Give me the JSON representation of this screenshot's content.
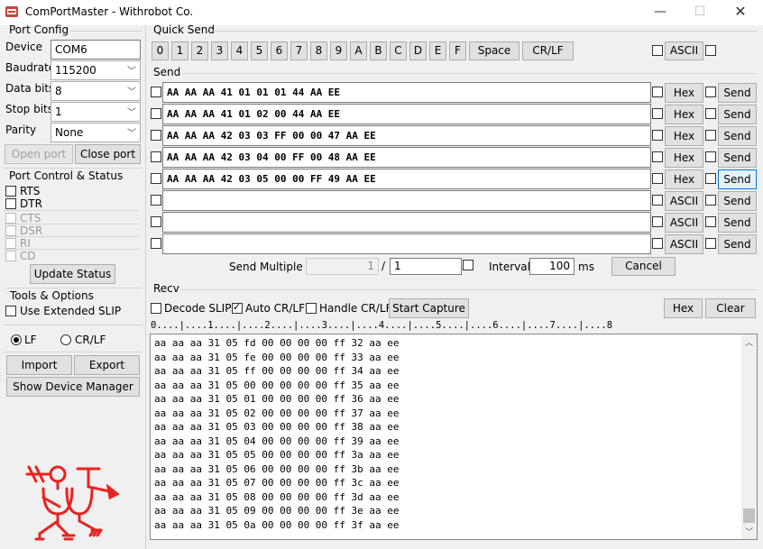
{
  "window": {
    "title": "ComPortMaster - Withrobot Co."
  },
  "port_config": {
    "title": "Port Config",
    "device_label": "Device",
    "device_value": "COM6",
    "baudrate_label": "Baudrate",
    "baudrate_value": "115200",
    "databits_label": "Data bits",
    "databits_value": "8",
    "stopbits_label": "Stop bits",
    "stopbits_value": "1",
    "parity_label": "Parity",
    "parity_value": "None",
    "open_label": "Open port",
    "close_label": "Close port"
  },
  "port_control": {
    "title": "Port Control & Status",
    "rts": "RTS",
    "dtr": "DTR",
    "cts": "CTS",
    "dsr": "DSR",
    "ri": "RI",
    "cd": "CD",
    "update_label": "Update Status"
  },
  "tools": {
    "title": "Tools & Options",
    "extended_slip": "Use Extended SLIP",
    "lf": "LF",
    "crlf": "CR/LF",
    "import_label": "Import",
    "export_label": "Export",
    "device_manager_label": "Show Device Manager"
  },
  "quick_send": {
    "title": "Quick Send",
    "keys": [
      "0",
      "1",
      "2",
      "3",
      "4",
      "5",
      "6",
      "7",
      "8",
      "9",
      "A",
      "B",
      "C",
      "D",
      "E",
      "F"
    ],
    "space_label": "Space",
    "crlf_label": "CR/LF",
    "ascii_label": "ASCII"
  },
  "send": {
    "title": "Send",
    "rows": [
      {
        "text": "AA AA AA 41 01 01 01 44 AA EE",
        "mode": "Hex",
        "send": "Send"
      },
      {
        "text": "AA AA AA 41 01 02 00 44 AA EE",
        "mode": "Hex",
        "send": "Send"
      },
      {
        "text": "AA AA AA 42 03 03 FF 00 00 47 AA EE",
        "mode": "Hex",
        "send": "Send"
      },
      {
        "text": "AA AA AA 42 03 04 00 FF 00 48 AA EE",
        "mode": "Hex",
        "send": "Send"
      },
      {
        "text": "AA AA AA 42 03 05 00 00 FF 49 AA EE",
        "mode": "Hex",
        "send": "Send"
      },
      {
        "text": "",
        "mode": "ASCII",
        "send": "Send"
      },
      {
        "text": "",
        "mode": "ASCII",
        "send": "Send"
      },
      {
        "text": "",
        "mode": "ASCII",
        "send": "Send"
      }
    ],
    "multiple_label": "Send Multiple :",
    "multiple_from": "1",
    "multiple_sep": "/",
    "multiple_to": "1",
    "interval_label": "Interval",
    "interval_value": "100",
    "interval_unit": "ms",
    "cancel_label": "Cancel"
  },
  "recv": {
    "title": "Recv",
    "decode_slip": "Decode SLIP",
    "auto_crlf": "Auto CR/LF",
    "handle_crlf": "Handle CR/LF",
    "start_capture": "Start Capture",
    "hex_label": "Hex",
    "clear_label": "Clear",
    "ruler": "0....|....1....|....2....|....3....|....4....|....5....|....6....|....7....|....8",
    "lines": [
      "aa aa aa 31 05 fd 00 00 00 00 ff 32 aa ee",
      "aa aa aa 31 05 fe 00 00 00 00 ff 33 aa ee",
      "aa aa aa 31 05 ff 00 00 00 00 ff 34 aa ee",
      "aa aa aa 31 05 00 00 00 00 00 ff 35 aa ee",
      "aa aa aa 31 05 01 00 00 00 00 ff 36 aa ee",
      "aa aa aa 31 05 02 00 00 00 00 ff 37 aa ee",
      "aa aa aa 31 05 03 00 00 00 00 ff 38 aa ee",
      "aa aa aa 31 05 04 00 00 00 00 ff 39 aa ee",
      "aa aa aa 31 05 05 00 00 00 00 ff 3a aa ee",
      "aa aa aa 31 05 06 00 00 00 00 ff 3b aa ee",
      "aa aa aa 31 05 07 00 00 00 00 ff 3c aa ee",
      "aa aa aa 31 05 08 00 00 00 00 ff 3d aa ee",
      "aa aa aa 31 05 09 00 00 00 00 ff 3e aa ee",
      "aa aa aa 31 05 0a 00 00 00 00 ff 3f aa ee"
    ]
  },
  "colors": {
    "logo": "#e8231f",
    "focus": "#0078d7"
  }
}
